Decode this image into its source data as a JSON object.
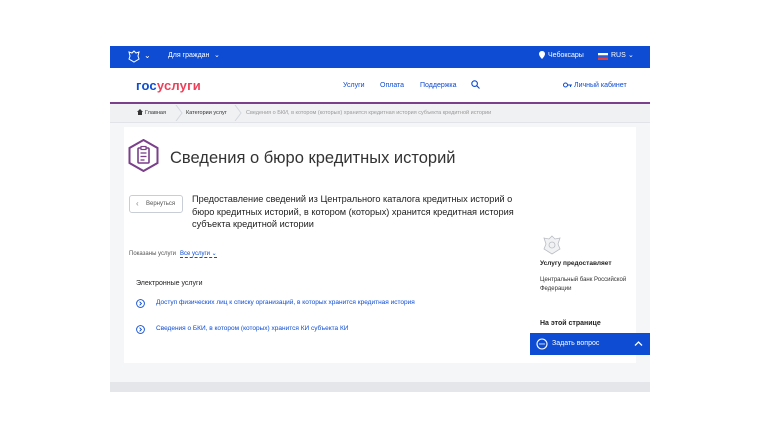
{
  "topbar": {
    "for_citizens": "Для граждан",
    "location": "Чебоксары",
    "language": "RUS"
  },
  "nav": {
    "logo_a": "гос",
    "logo_b": "услуги",
    "links": [
      "Услуги",
      "Оплата",
      "Поддержка"
    ],
    "cabinet": "Личный кабинет"
  },
  "breadcrumbs": [
    "Главная",
    "Категории услуг",
    "Сведения о БКИ, в котором (которых) хранится кредитная история субъекта кредитной истории"
  ],
  "page": {
    "title": "Сведения о бюро кредитных историй",
    "back_label": "Вернуться",
    "description": "Предоставление сведений из Центрального каталога кредитных историй о бюро кредитных историй, в котором (которых) хранится кредитная история субъекта кредитной истории",
    "shown_label": "Показаны услуги",
    "shown_value": "Все услуги",
    "electronic_heading": "Электронные услуги",
    "services": [
      "Доступ физических лиц к списку организаций, в которых хранится кредитная история",
      "Сведения о БКИ, в котором (которых) хранится КИ субъекта КИ"
    ]
  },
  "sidebar": {
    "provider_heading": "Услугу предоставляет",
    "provider_name": "Центральный банк Российской Федерации",
    "on_page": "На этой странице",
    "ask_label": "Задать вопрос"
  },
  "colors": {
    "brand_blue": "#0d4cd3",
    "brand_red": "#ee3f58",
    "accent_purple": "#7b3f8c"
  }
}
